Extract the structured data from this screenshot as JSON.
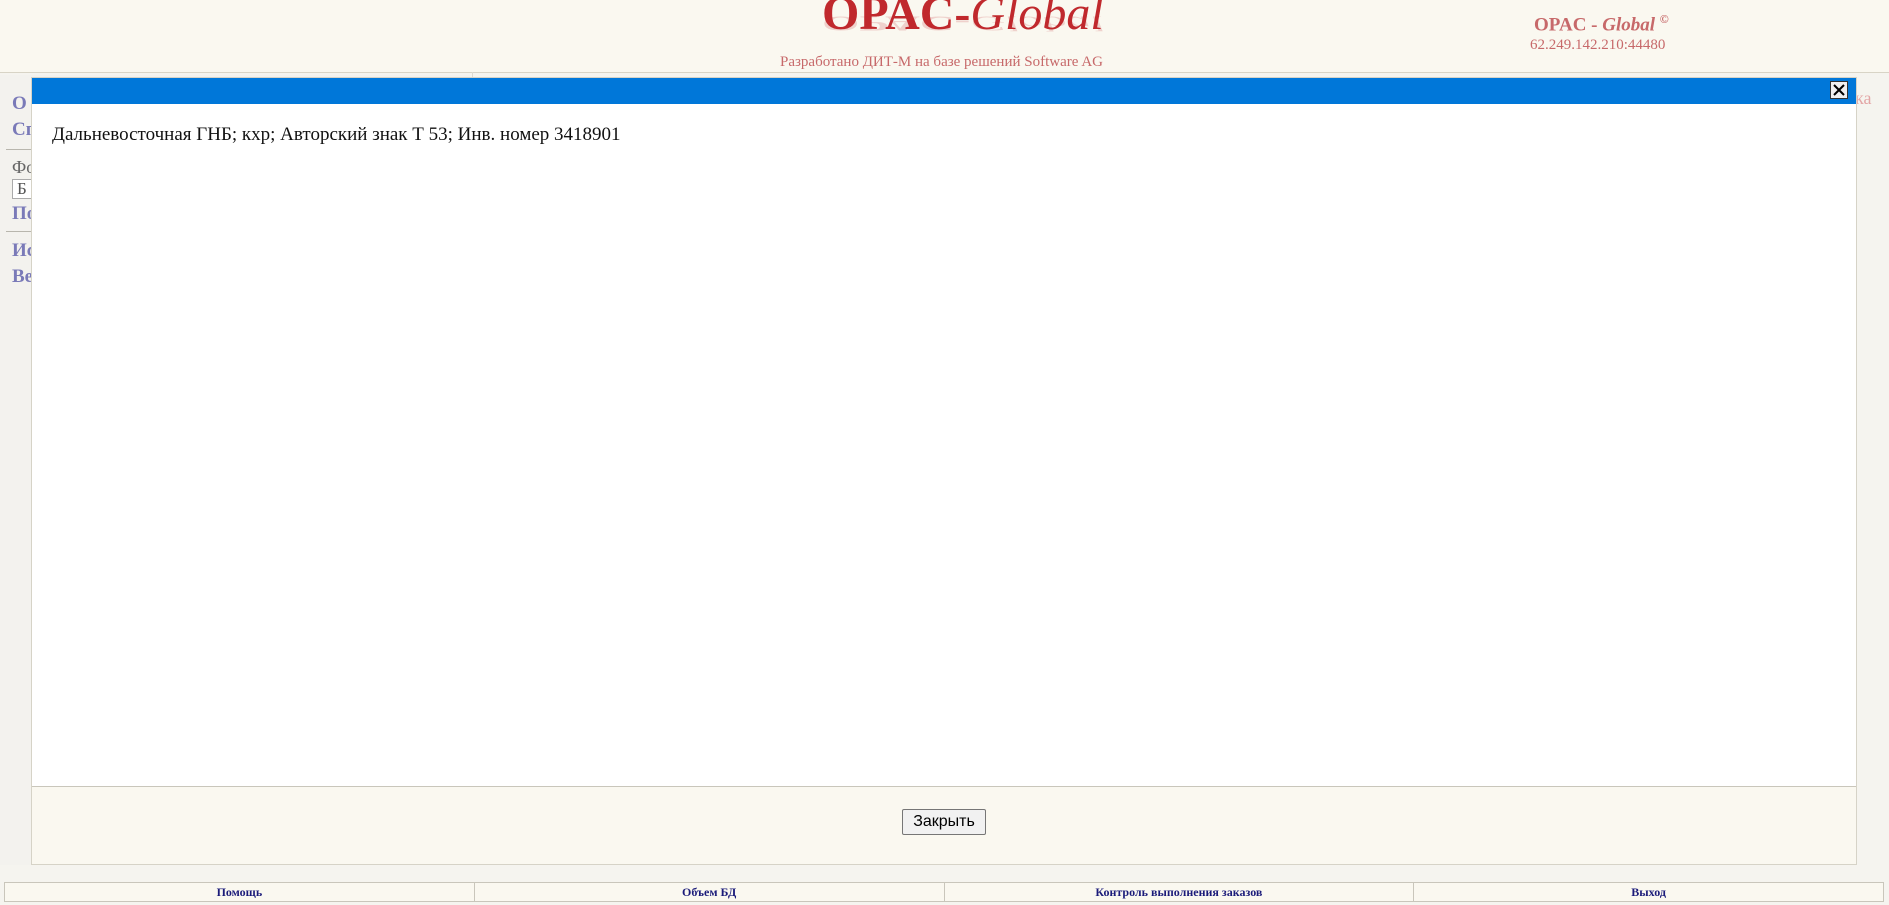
{
  "header": {
    "logo_main": "OPAC-",
    "logo_italic": "Global",
    "subtitle": "Разработано ДИТ-М на базе решений Software AG",
    "brand_prefix": "OPAC - ",
    "brand_italic": "Global",
    "brand_mark": "©",
    "host": "62.249.142.210:44480"
  },
  "leftnav": {
    "item1": "О",
    "item2": "Сп",
    "label": "Фо",
    "input_value": "Б",
    "item3": "По",
    "item4": "Ис",
    "item5": "Ве",
    "right_hint": "ка"
  },
  "modal": {
    "close_icon": "close-x",
    "record_text": "Дальневосточная ГНБ; кхр; Авторский знак Т 53; Инв. номер 3418901",
    "close_button": "Закрыть",
    "titlebar_color": "#0077d9"
  },
  "bottombar": {
    "help": "Помощь",
    "db_volume": "Объем БД",
    "orders": "Контроль выполнения заказов",
    "exit": "Выход"
  }
}
